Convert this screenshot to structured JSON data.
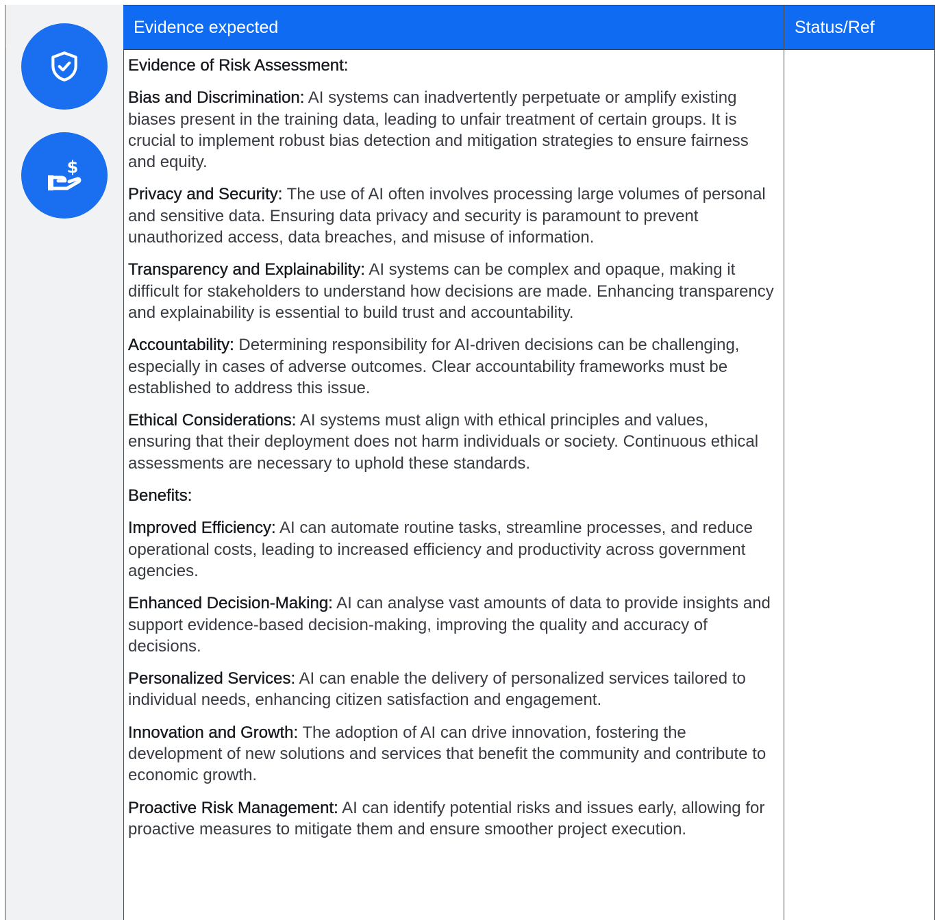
{
  "header": {
    "evidence_label": "Evidence expected",
    "status_label": "Status/Ref"
  },
  "icons": {
    "first": "shield-check-icon",
    "second": "hand-dollar-icon",
    "badge_color": "#1a6ff0",
    "header_color": "#0f6cf2"
  },
  "risk_section": {
    "heading": "Evidence of Risk Assessment:",
    "items": [
      {
        "term": "Bias and Discrimination:",
        "text": " AI systems can inadvertently perpetuate or amplify existing biases present in the training data, leading to unfair treatment of certain groups. It is crucial to implement robust bias detection and mitigation strategies to ensure fairness and equity."
      },
      {
        "term": "Privacy and Security:",
        "text": " The use of AI often involves processing large volumes of personal and sensitive data. Ensuring data privacy and security is paramount to prevent unauthorized access, data breaches, and misuse of information."
      },
      {
        "term": "Transparency and Explainability:",
        "text": " AI systems can be complex and opaque, making it difficult for stakeholders to understand how decisions are made. Enhancing transparency and explainability is essential to build trust and accountability."
      },
      {
        "term": "Accountability:",
        "text": " Determining responsibility for AI-driven decisions can be challenging, especially in cases of adverse outcomes. Clear accountability frameworks must be established to address this issue."
      },
      {
        "term": "Ethical Considerations:",
        "text": " AI systems must align with ethical principles and values, ensuring that their deployment does not harm individuals or society. Continuous ethical assessments are necessary to uphold these standards."
      }
    ]
  },
  "benefits_section": {
    "heading": "Benefits:",
    "items": [
      {
        "term": "Improved Efficiency:",
        "text": " AI can automate routine tasks, streamline processes, and reduce operational costs, leading to increased efficiency and productivity across government agencies."
      },
      {
        "term": "Enhanced Decision-Making:",
        "text": " AI can analyse vast amounts of data to provide insights and support evidence-based decision-making, improving the quality and accuracy of decisions."
      },
      {
        "term": "Personalized Services:",
        "text": " AI can enable the delivery of personalized services tailored to individual needs, enhancing citizen satisfaction and engagement."
      },
      {
        "term": "Innovation and Growth:",
        "text": " The adoption of AI can drive innovation, fostering the development of new solutions and services that benefit the community and contribute to economic growth."
      },
      {
        "term": "Proactive Risk Management:",
        "text": " AI can identify potential risks and issues early, allowing for proactive measures to mitigate them and ensure smoother project execution."
      }
    ]
  }
}
